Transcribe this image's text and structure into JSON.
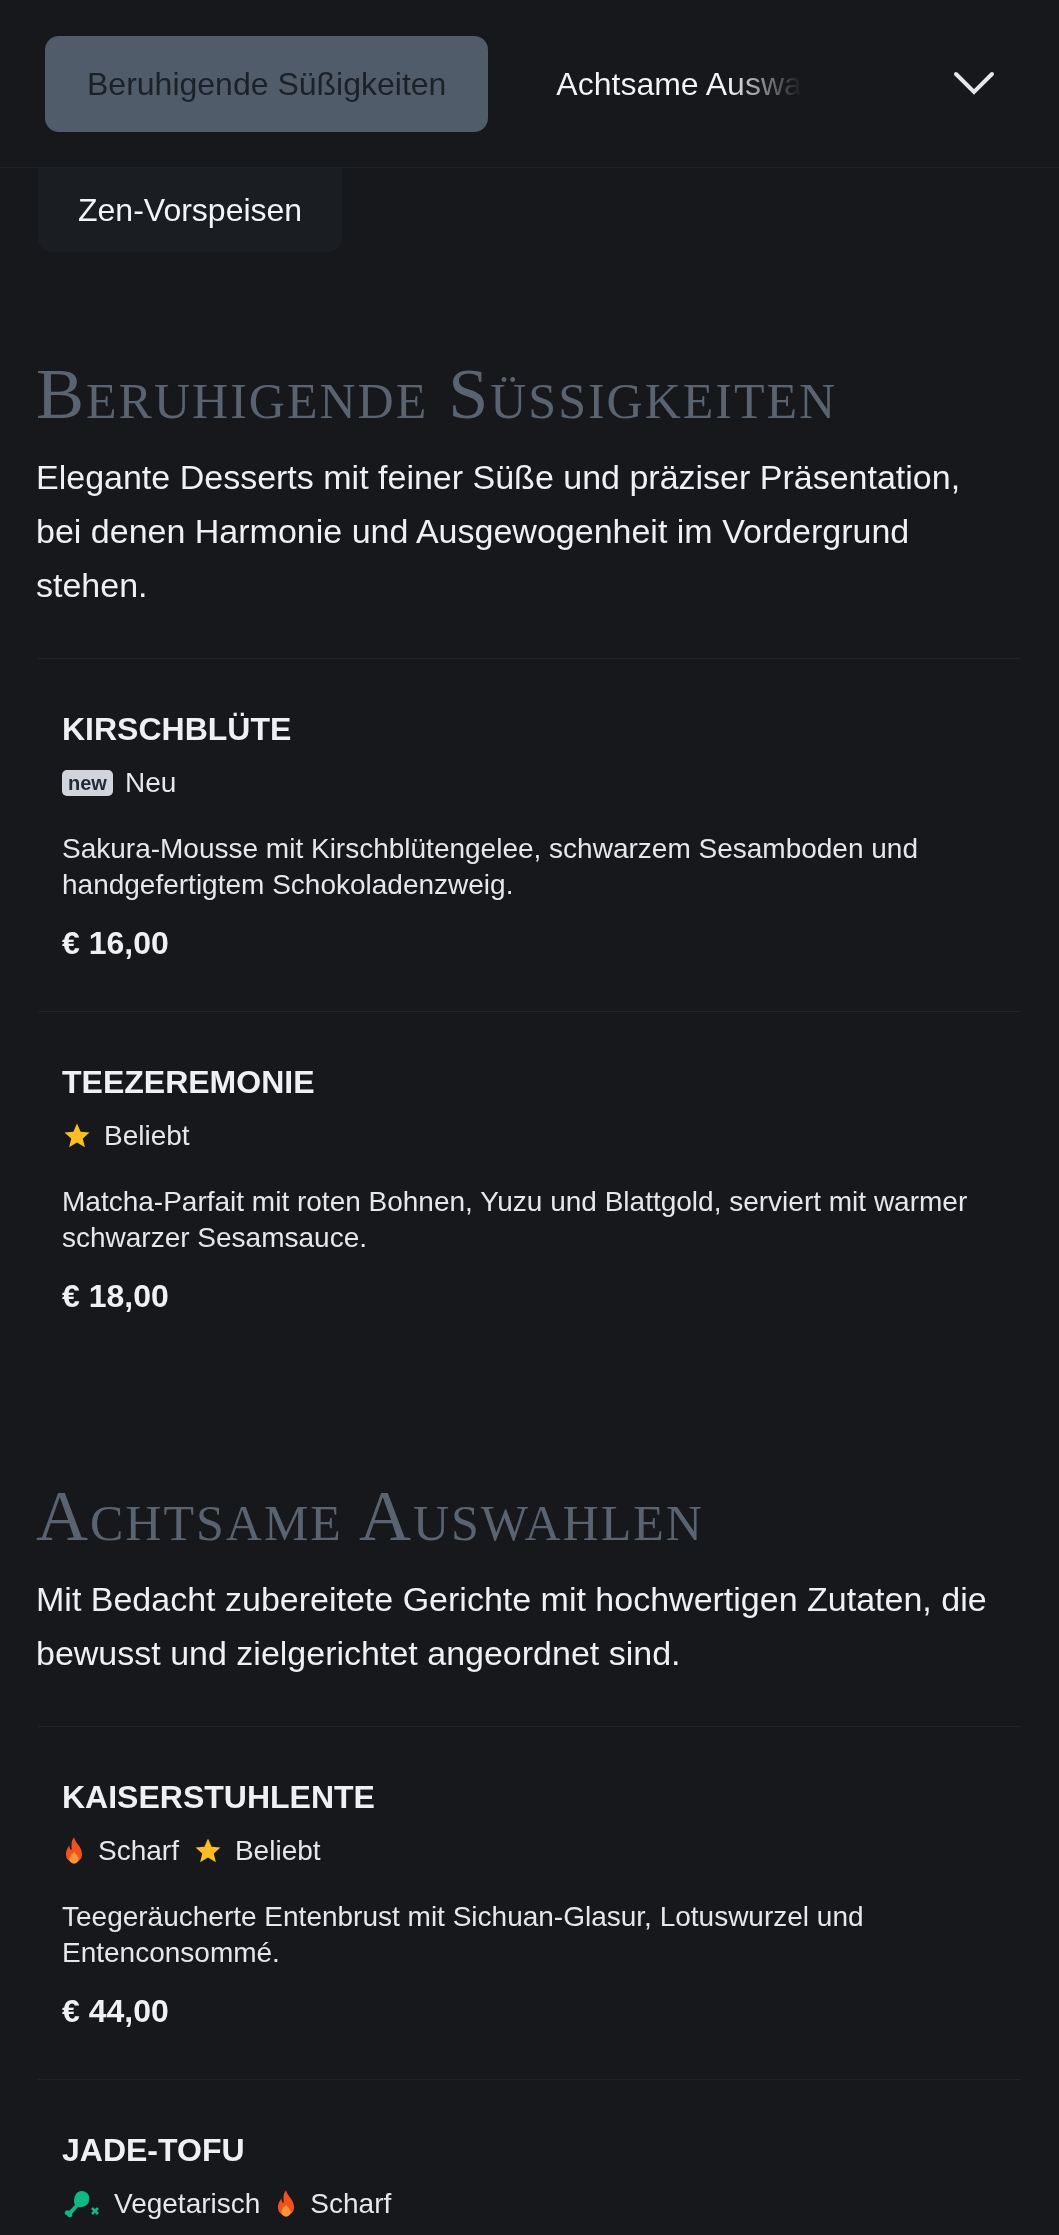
{
  "category_tabs": [
    {
      "label": "Beruhigende Süßigkeiten",
      "selected": true
    },
    {
      "label": "Achtsame Auswa",
      "selected": false
    },
    {
      "label": "Zen-Vorspeisen",
      "selected": false
    }
  ],
  "sections": [
    {
      "title": "Beruhigende Süssigkeiten",
      "description": "Elegante Desserts mit feiner Süße und präziser Präsentation, bei denen Harmonie und Ausgewogenheit im Vordergrund stehen.",
      "dishes": [
        {
          "name": "KIRSCHBLÜTE",
          "tags": [
            {
              "kind": "new",
              "icon_text": "new",
              "label": "Neu"
            }
          ],
          "description": "Sakura-Mousse mit Kirschblütengelee, schwarzem Sesamboden und handgefertigtem Schokoladenzweig.",
          "price": "€ 16,00"
        },
        {
          "name": "TEEZEREMONIE",
          "tags": [
            {
              "kind": "popular",
              "label": "Beliebt"
            }
          ],
          "description": "Matcha-Parfait mit roten Bohnen, Yuzu und Blattgold, serviert mit warmer schwarzer Sesamsauce.",
          "price": "€ 18,00"
        }
      ]
    },
    {
      "title": "Achtsame Auswahlen",
      "description": "Mit Bedacht zubereitete Gerichte mit hochwertigen Zutaten, die bewusst und zielgerichtet angeordnet sind.",
      "dishes": [
        {
          "name": "KAISERSTUHLENTE",
          "tags": [
            {
              "kind": "spicy",
              "label": "Scharf"
            },
            {
              "kind": "popular",
              "label": "Beliebt"
            }
          ],
          "description": "Teegeräucherte Entenbrust mit Sichuan-Glasur, Lotuswurzel und Entenconsommé.",
          "price": "€ 44,00"
        },
        {
          "name": "JADE-TOFU",
          "tags": [
            {
              "kind": "vegetarian",
              "label": "Vegetarisch"
            },
            {
              "kind": "spicy",
              "label": "Scharf"
            }
          ]
        }
      ]
    }
  ]
}
